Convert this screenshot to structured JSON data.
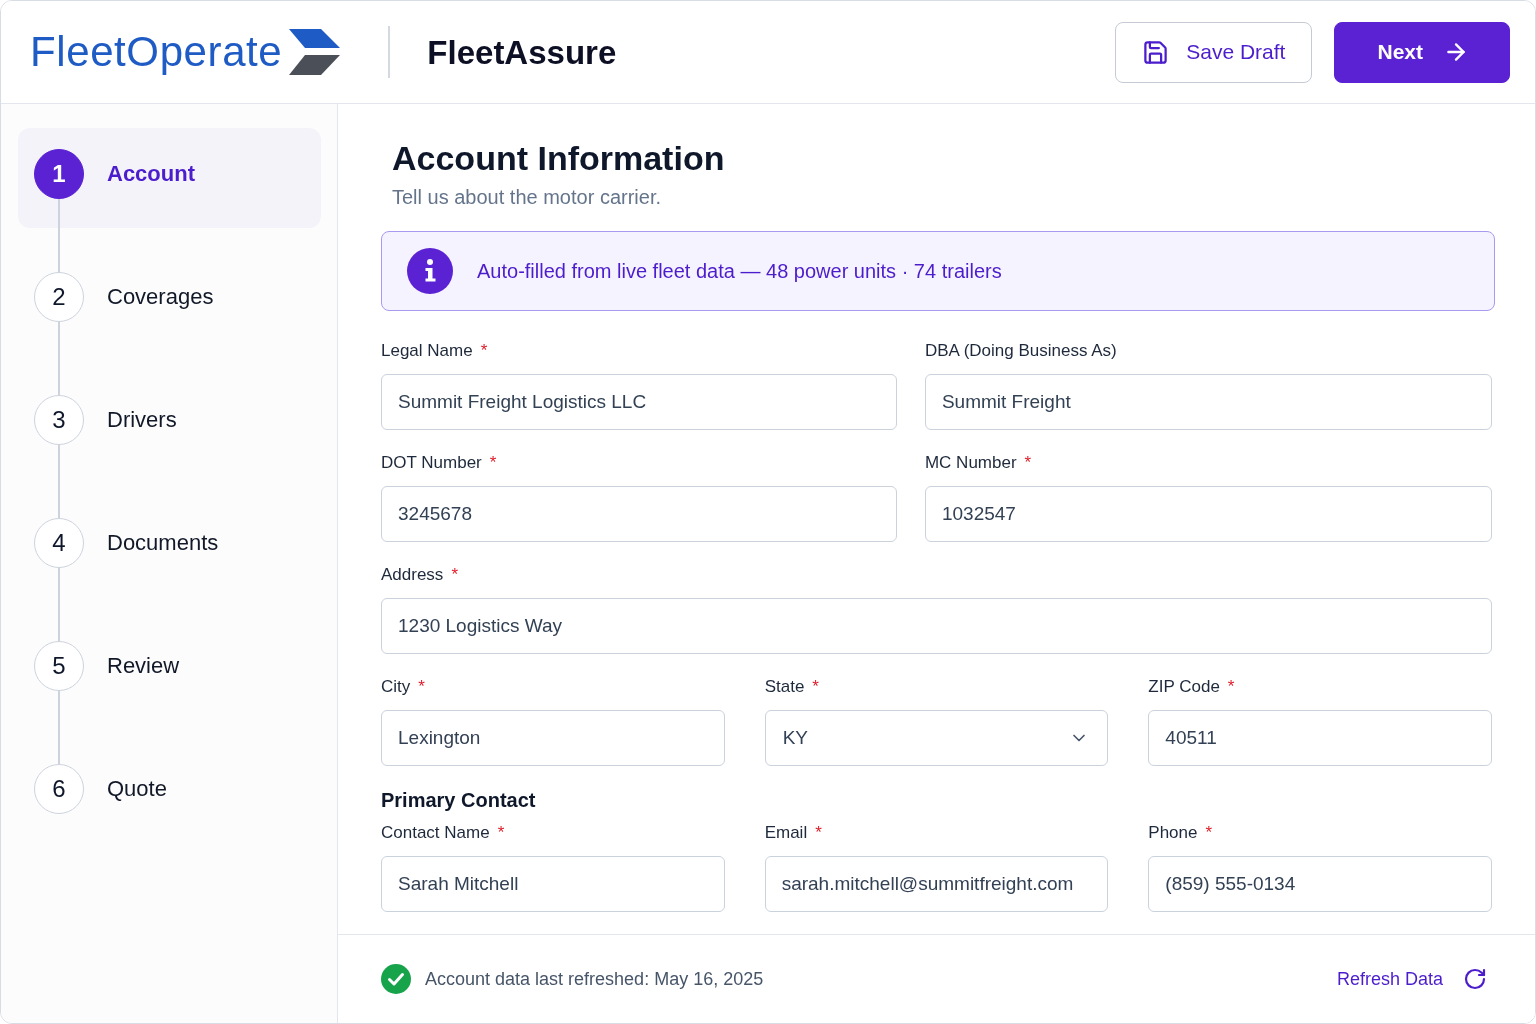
{
  "header": {
    "logo": "FleetOperate",
    "product": "FleetAssure",
    "actions": [
      {
        "kind": "secondary",
        "label": "Save Draft"
      },
      {
        "kind": "primary",
        "label": "Next"
      }
    ]
  },
  "steps": [
    {
      "number": "1",
      "label": "Account",
      "selected": true
    },
    {
      "number": "2",
      "label": "Coverages",
      "selected": false
    },
    {
      "number": "3",
      "label": "Drivers",
      "selected": false
    },
    {
      "number": "4",
      "label": "Documents",
      "selected": false
    },
    {
      "number": "5",
      "label": "Review",
      "selected": false
    },
    {
      "number": "6",
      "label": "Quote",
      "selected": false
    }
  ],
  "page": {
    "title": "Account Information",
    "subtitle": "Tell us about the motor carrier."
  },
  "notice": {
    "kind": "info",
    "text": "Auto-filled from live fleet data — 48 power units · 74 trailers"
  },
  "form": {
    "required_mark": "*",
    "rows": [
      {
        "kind": "fields",
        "fields": [
          {
            "label": "Legal Name",
            "required": true,
            "kind": "text",
            "value": "Summit Freight Logistics LLC"
          },
          {
            "label": "DBA (Doing Business As)",
            "required": false,
            "kind": "text",
            "value": "Summit Freight"
          }
        ]
      },
      {
        "kind": "fields",
        "fields": [
          {
            "label": "DOT Number",
            "required": true,
            "kind": "text",
            "value": "3245678"
          },
          {
            "label": "MC Number",
            "required": true,
            "kind": "text",
            "value": "1032547"
          }
        ]
      },
      {
        "kind": "fields",
        "fields": [
          {
            "label": "Address",
            "required": true,
            "kind": "text",
            "value": "1230 Logistics Way"
          }
        ]
      },
      {
        "kind": "fields",
        "fields": [
          {
            "label": "City",
            "required": true,
            "kind": "text",
            "value": "Lexington"
          },
          {
            "label": "State",
            "required": true,
            "kind": "select",
            "value": "KY"
          },
          {
            "label": "ZIP Code",
            "required": true,
            "kind": "text",
            "value": "40511"
          }
        ]
      },
      {
        "kind": "heading",
        "text": "Primary Contact"
      },
      {
        "kind": "fields",
        "fields": [
          {
            "label": "Contact Name",
            "required": true,
            "kind": "text",
            "value": "Sarah Mitchell"
          },
          {
            "label": "Email",
            "required": true,
            "kind": "text",
            "value": "sarah.mitchell@summitfreight.com"
          },
          {
            "label": "Phone",
            "required": true,
            "kind": "text",
            "value": "(859) 555-0134"
          }
        ]
      }
    ]
  },
  "status_bar": {
    "kind": "success",
    "text": "Account data last refreshed: May 16, 2025",
    "action": "Refresh Data"
  }
}
